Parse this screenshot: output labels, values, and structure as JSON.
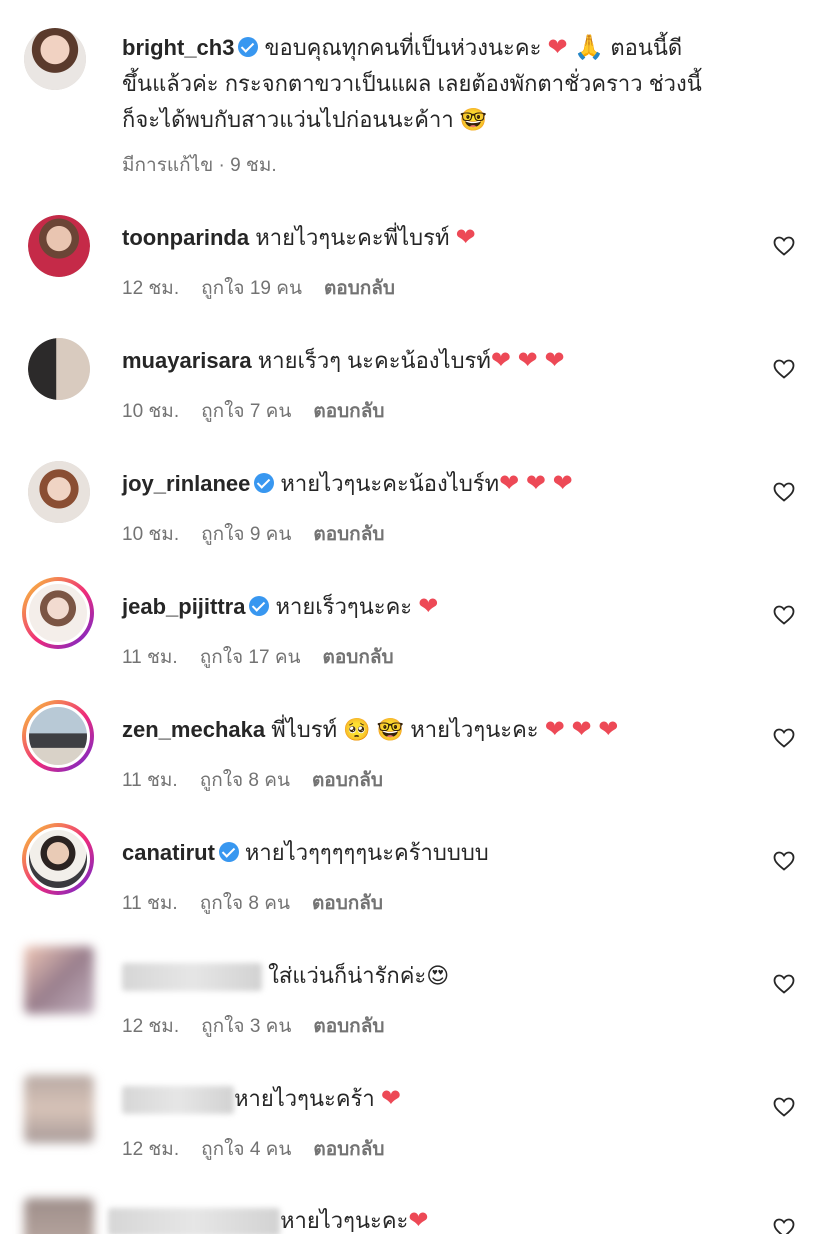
{
  "caption": {
    "username": "bright_ch3",
    "verified": true,
    "text_line1": "ขอบคุณทุกคนที่เป็นห่วงนะคะ",
    "emoji_line1": "❤ 🙏",
    "text_line1_end": "ตอนนี้ดี",
    "text_line2": "ขึ้นแล้วค่ะ กระจกตาขวาเป็นแผล เลยต้องพักตาชั่วคราว ช่วงนี้",
    "text_line3": "ก็จะได้พบกับสาวแว่นไปก่อนนะค้าา",
    "emoji_line3": "🤓",
    "meta": "มีการแก้ไข · 9 ชม."
  },
  "comments": [
    {
      "username": "toonparinda",
      "verified": false,
      "text": "หายไวๆนะคะพี่ไบรท์",
      "emoji": "❤",
      "time": "12 ชม.",
      "likes": "ถูกใจ 19 คน",
      "reply": "ตอบกลับ"
    },
    {
      "username": "muayarisara",
      "verified": false,
      "text": "หายเร็วๆ นะคะน้องไบรท์",
      "emoji": "❤ ❤ ❤",
      "time": "10 ชม.",
      "likes": "ถูกใจ 7 คน",
      "reply": "ตอบกลับ"
    },
    {
      "username": "joy_rinlanee",
      "verified": true,
      "text": "หายไวๆนะคะน้องไบร์ท",
      "emoji": "❤ ❤ ❤",
      "time": "10 ชม.",
      "likes": "ถูกใจ 9 คน",
      "reply": "ตอบกลับ"
    },
    {
      "username": "jeab_pijittra",
      "verified": true,
      "text": "หายเร็วๆนะคะ",
      "emoji": "❤",
      "time": "11 ชม.",
      "likes": "ถูกใจ 17 คน",
      "reply": "ตอบกลับ"
    },
    {
      "username": "zen_mechaka",
      "verified": false,
      "text": "พี่ไบรท์",
      "emoji_mid": "🥺 🤓",
      "text2": "หายไวๆนะคะ",
      "emoji": "❤ ❤ ❤",
      "time": "11 ชม.",
      "likes": "ถูกใจ 8 คน",
      "reply": "ตอบกลับ"
    },
    {
      "username": "canatirut",
      "verified": true,
      "text": "หายไวๆๆๆๆๆนะคร้าบบบบ",
      "emoji": "",
      "time": "11 ชม.",
      "likes": "ถูกใจ 8 คน",
      "reply": "ตอบกลับ"
    },
    {
      "username": "",
      "verified": false,
      "text": "ใส่แว่นก็น่ารักค่ะ",
      "emoji": "😍",
      "time": "12 ชม.",
      "likes": "ถูกใจ 3 คน",
      "reply": "ตอบกลับ"
    },
    {
      "username": "",
      "verified": false,
      "text": "หายไวๆนะคร้า",
      "emoji": "❤",
      "time": "12 ชม.",
      "likes": "ถูกใจ 4 คน",
      "reply": "ตอบกลับ"
    },
    {
      "username": "",
      "verified": false,
      "text": "หายไวๆนะคะ",
      "emoji": "❤",
      "time": "",
      "likes": "",
      "reply": ""
    }
  ],
  "icons": {
    "like": "heart-outline-icon",
    "verified": "verified-badge-icon"
  },
  "colors": {
    "heart": "#ed4956",
    "verified": "#3897f0",
    "meta": "#737373",
    "text": "#262626"
  }
}
